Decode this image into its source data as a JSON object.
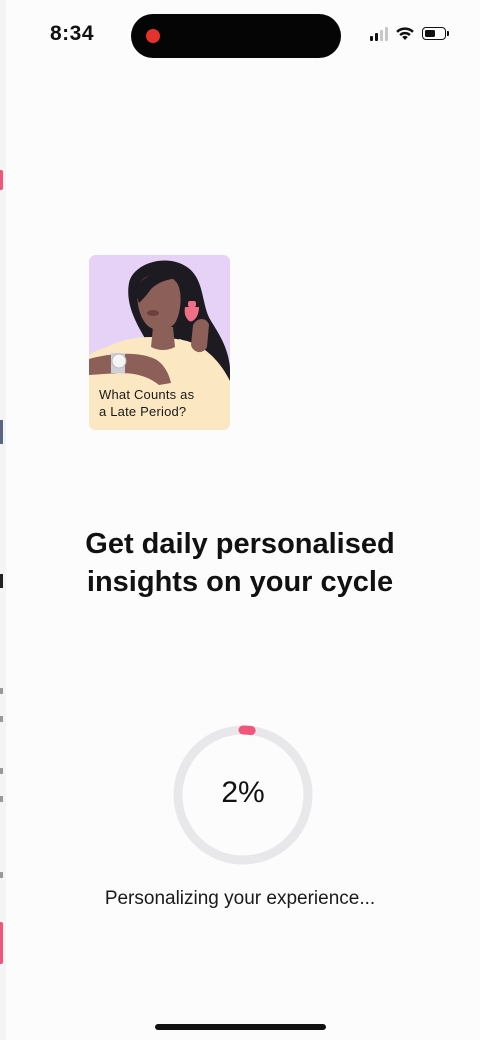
{
  "status_bar": {
    "time": "8:34"
  },
  "card": {
    "caption_line1": "What Counts as",
    "caption_line2": "a Late Period?",
    "background_color": "#e6d2f6"
  },
  "headline": {
    "line1": "Get daily personalised",
    "line2": "insights on your cycle"
  },
  "progress": {
    "value_text": "2%",
    "percent": 2,
    "label": "Personalizing your experience...",
    "accent_color": "#f0557a",
    "track_color": "#e8e7ea"
  },
  "icons": [
    "recording-dot-icon",
    "cellular-signal-icon",
    "wifi-icon",
    "battery-icon"
  ]
}
